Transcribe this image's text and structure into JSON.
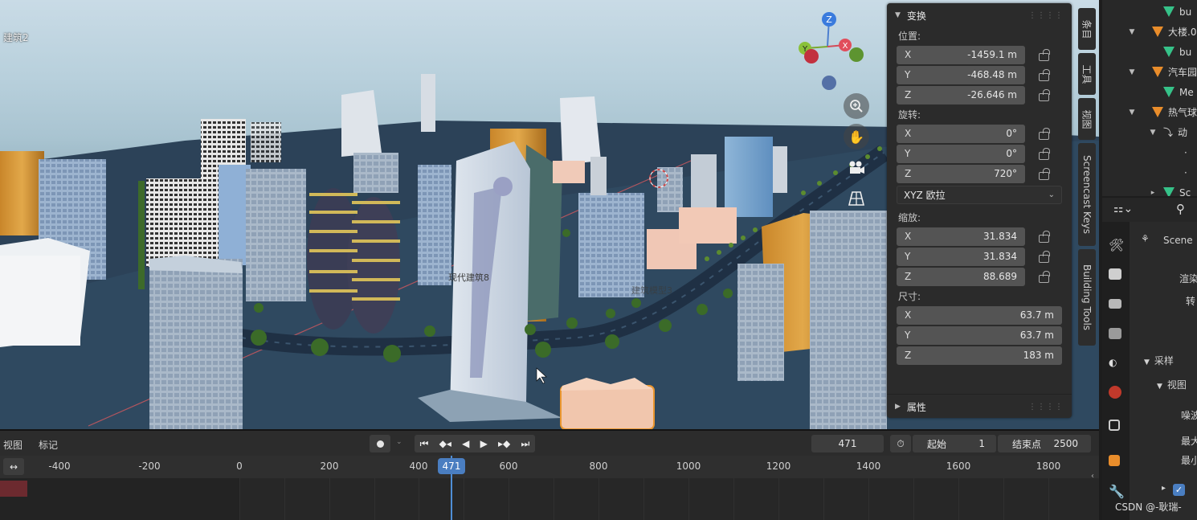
{
  "viewport": {
    "label": "建筑2",
    "scene_labels": [
      "现代建筑8",
      "建筑模型3"
    ]
  },
  "n_panel": {
    "transform_title": "变换",
    "location_label": "位置:",
    "location": [
      {
        "axis": "X",
        "value": "-1459.1 m"
      },
      {
        "axis": "Y",
        "value": "-468.48 m"
      },
      {
        "axis": "Z",
        "value": "-26.646 m"
      }
    ],
    "rotation_label": "旋转:",
    "rotation": [
      {
        "axis": "X",
        "value": "0°"
      },
      {
        "axis": "Y",
        "value": "0°"
      },
      {
        "axis": "Z",
        "value": "720°"
      }
    ],
    "rotation_mode": "XYZ 欧拉",
    "scale_label": "缩放:",
    "scale": [
      {
        "axis": "X",
        "value": "31.834"
      },
      {
        "axis": "Y",
        "value": "31.834"
      },
      {
        "axis": "Z",
        "value": "88.689"
      }
    ],
    "dimensions_label": "尺寸:",
    "dimensions": [
      {
        "axis": "X",
        "value": "63.7 m"
      },
      {
        "axis": "Y",
        "value": "63.7 m"
      },
      {
        "axis": "Z",
        "value": "183 m"
      }
    ],
    "properties_title": "属性"
  },
  "side_tabs": [
    "条目",
    "工具",
    "视图",
    "Screencast Keys",
    "Building Tools"
  ],
  "outliner": {
    "rows": [
      {
        "label": "bu",
        "icon": "mesh-data-icon",
        "indent": 2
      },
      {
        "label": "大楼.0",
        "icon": "object-icon",
        "indent": 1
      },
      {
        "label": "bu",
        "icon": "mesh-data-icon",
        "indent": 2
      },
      {
        "label": "汽车园",
        "icon": "object-icon",
        "indent": 1
      },
      {
        "label": "Me",
        "icon": "mesh-data-icon",
        "indent": 2
      },
      {
        "label": "热气球",
        "icon": "object-icon",
        "indent": 1
      },
      {
        "label": "动",
        "icon": "animation-icon",
        "indent": 2
      },
      {
        "label": "",
        "icon": "dot-icon",
        "indent": 3
      },
      {
        "label": "",
        "icon": "dot-icon",
        "indent": 3
      },
      {
        "label": "Sc",
        "icon": "mesh-data-icon",
        "indent": 2
      }
    ]
  },
  "properties": {
    "scene_label": "Scene",
    "item_a": "渲染",
    "item_b": "转",
    "sampling": "采样",
    "viewport_sub": "视图",
    "row_1": "噪波",
    "row_2": "最大",
    "row_3": "最小"
  },
  "timeline": {
    "view_menu": "视图",
    "marker_menu": "标记",
    "current_frame": "471",
    "start_label": "起始",
    "start_value": "1",
    "end_label": "结束点",
    "end_value": "2500",
    "ruler_ticks": [
      "-400",
      "-200",
      "0",
      "200",
      "400",
      "600",
      "800",
      "1000",
      "1200",
      "1400",
      "1600",
      "1800"
    ],
    "playhead_label": "471"
  },
  "watermark": "CSDN @-耿瑞-"
}
